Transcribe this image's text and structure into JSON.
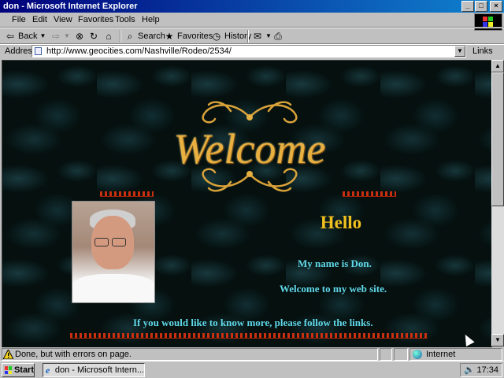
{
  "window": {
    "title": "don - Microsoft Internet Explorer"
  },
  "menu": [
    "File",
    "Edit",
    "View",
    "Favorites",
    "Tools",
    "Help"
  ],
  "toolbar": {
    "back": "Back",
    "search": "Search",
    "favorites": "Favorites",
    "history": "History"
  },
  "address": {
    "label": "Address",
    "url": "http://www.geocities.com/Nashville/Rodeo/2534/",
    "links": "Links"
  },
  "page": {
    "banner": "Welcome",
    "hello": "Hello",
    "line1": "My name is Don.",
    "line2": "Welcome to my web site.",
    "line3": "If you would like to know more, please follow the links."
  },
  "status": {
    "text": "Done, but with errors on page.",
    "zone": "Internet"
  },
  "taskbar": {
    "start": "Start",
    "task": "don - Microsoft Intern...",
    "clock": "17:34"
  },
  "colors": {
    "title_bar": "#00007b",
    "hello": "#f0c020",
    "page_text": "#60d8e8",
    "banner_gold": "#e8b040",
    "divider": "#c83010"
  }
}
